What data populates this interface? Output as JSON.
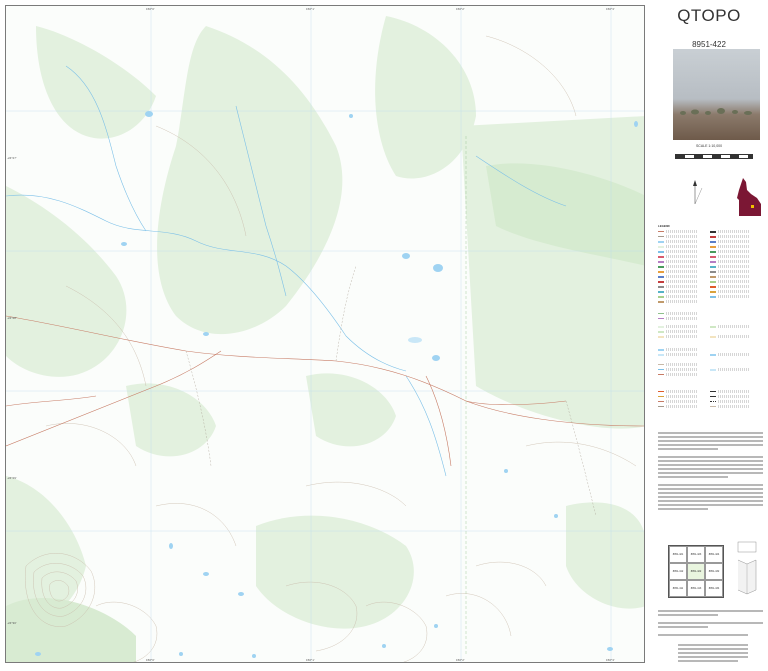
{
  "map": {
    "title": "QTOPO",
    "sheet_number": "8951-422",
    "scale": "SCALE 1:10,000",
    "grid_ticks_top": [
      "150°0'",
      "150°1'",
      "150°2'",
      "150°3'"
    ],
    "grid_ticks_bottom": [
      "150°0'",
      "150°1'",
      "150°2'",
      "150°3'"
    ],
    "grid_ticks_left": [
      "-24°27'",
      "-24°28'",
      "-24°29'",
      "-24°30'"
    ]
  },
  "panel": {
    "legend_heading": "LEGEND",
    "index_cells": [
      "8951-421",
      "8951-423",
      "8951-424",
      "8951-412",
      "8951-422",
      "8951-432",
      "8951-411",
      "8951-413",
      "8951-434"
    ]
  },
  "colors": {
    "vegetation": "#e3f1df",
    "water": "#9fd3f2",
    "contour": "#c8b9a8",
    "road": "#c77b65",
    "grid": "#b8d8ee",
    "qld_fill": "#7b1734"
  }
}
